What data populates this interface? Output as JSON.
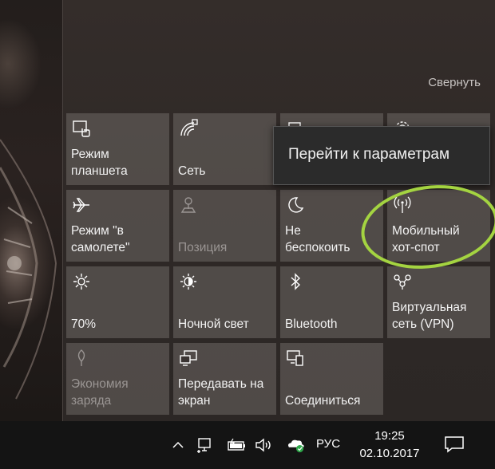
{
  "panel": {
    "collapse_label": "Свернуть"
  },
  "tiles": [
    {
      "label": "Режим\nпланшета",
      "icon": "tablet-mode-icon"
    },
    {
      "label": "Сеть",
      "icon": "network-icon"
    },
    {
      "label": "",
      "icon": "note-icon"
    },
    {
      "label": "",
      "icon": "settings-icon"
    },
    {
      "label": "Режим \"в\nсамолете\"",
      "icon": "airplane-icon"
    },
    {
      "label": "Позиция",
      "icon": "location-icon",
      "disabled": true
    },
    {
      "label": "Не\nбеспокоить",
      "icon": "moon-icon"
    },
    {
      "label": "Мобильный\nхот-спот",
      "icon": "hotspot-icon"
    },
    {
      "label": "70%",
      "icon": "brightness-icon"
    },
    {
      "label": "Ночной свет",
      "icon": "night-light-icon"
    },
    {
      "label": "Bluetooth",
      "icon": "bluetooth-icon"
    },
    {
      "label": "Виртуальная\nсеть (VPN)",
      "icon": "vpn-icon"
    },
    {
      "label": "Экономия\nзаряда",
      "icon": "battery-saver-icon",
      "disabled": true
    },
    {
      "label": "Передавать на\nэкран",
      "icon": "project-icon"
    },
    {
      "label": "Соединиться",
      "icon": "connect-icon"
    }
  ],
  "tooltip": {
    "text": "Перейти к параметрам"
  },
  "taskbar": {
    "language": "РУС",
    "time": "19:25",
    "date": "02.10.2017",
    "icons": [
      "chevron-up-icon",
      "network-wired-icon",
      "battery-icon",
      "volume-icon",
      "onedrive-icon",
      "notifications-icon"
    ]
  },
  "colors": {
    "highlight": "#a4d441",
    "tile_bg": "#6e6865",
    "taskbar_bg": "#141414"
  }
}
